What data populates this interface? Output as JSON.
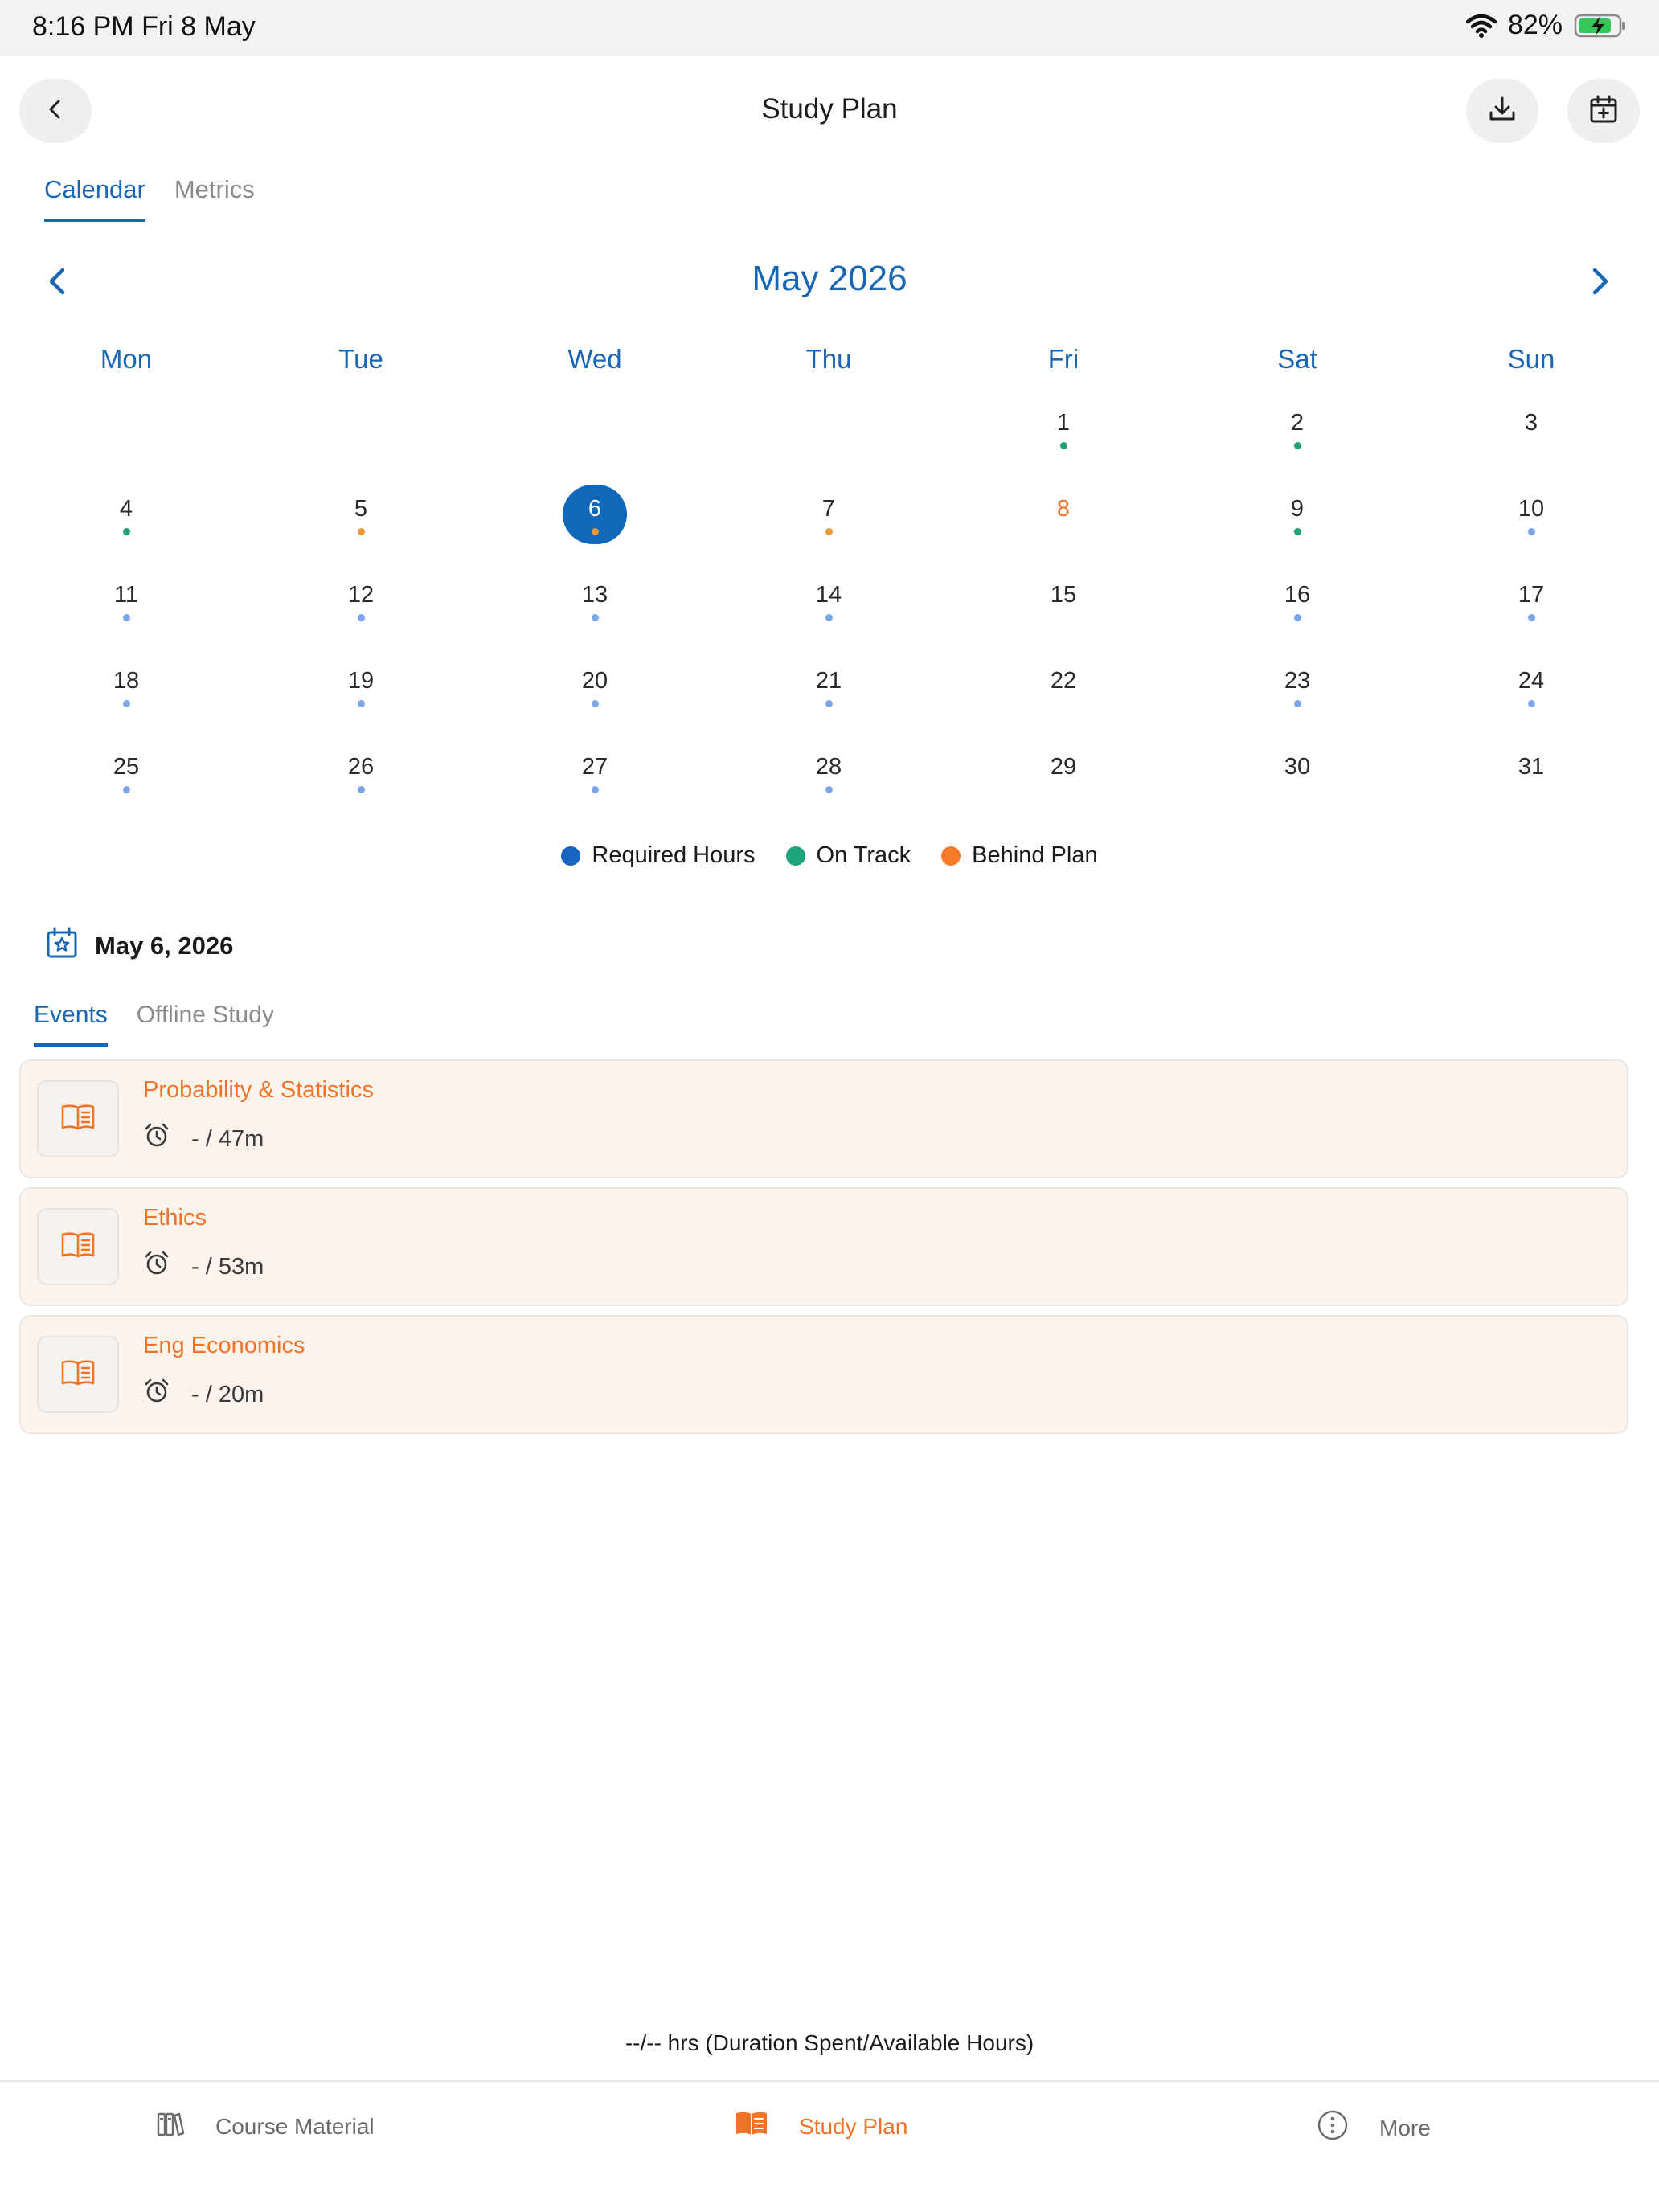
{
  "status_bar": {
    "time": "8:16 PM   Fri 8 May",
    "battery": "82%",
    "icons": [
      "wifi-icon",
      "battery-charging-icon"
    ]
  },
  "header": {
    "title": "Study Plan",
    "icons": [
      "chevron-left-icon",
      "download-icon",
      "calendar-add-icon"
    ]
  },
  "top_tabs": [
    {
      "label": "Calendar",
      "active": true
    },
    {
      "label": "Metrics",
      "active": false
    }
  ],
  "calendar": {
    "month_title": "May 2026",
    "weekdays": [
      "Mon",
      "Tue",
      "Wed",
      "Thu",
      "Fri",
      "Sat",
      "Sun"
    ],
    "selected_day": "6",
    "today": "8",
    "days": [
      {
        "d": "1",
        "col": 4,
        "row": 0,
        "dot": "green"
      },
      {
        "d": "2",
        "col": 5,
        "row": 0,
        "dot": "green"
      },
      {
        "d": "3",
        "col": 6,
        "row": 0,
        "dot": ""
      },
      {
        "d": "4",
        "col": 0,
        "row": 1,
        "dot": "green"
      },
      {
        "d": "5",
        "col": 1,
        "row": 1,
        "dot": "orange"
      },
      {
        "d": "6",
        "col": 2,
        "row": 1,
        "dot": "orange"
      },
      {
        "d": "7",
        "col": 3,
        "row": 1,
        "dot": "orange"
      },
      {
        "d": "8",
        "col": 4,
        "row": 1,
        "dot": ""
      },
      {
        "d": "9",
        "col": 5,
        "row": 1,
        "dot": "green"
      },
      {
        "d": "10",
        "col": 6,
        "row": 1,
        "dot": "blue"
      },
      {
        "d": "11",
        "col": 0,
        "row": 2,
        "dot": "blue"
      },
      {
        "d": "12",
        "col": 1,
        "row": 2,
        "dot": "blue"
      },
      {
        "d": "13",
        "col": 2,
        "row": 2,
        "dot": "blue"
      },
      {
        "d": "14",
        "col": 3,
        "row": 2,
        "dot": "blue"
      },
      {
        "d": "15",
        "col": 4,
        "row": 2,
        "dot": ""
      },
      {
        "d": "16",
        "col": 5,
        "row": 2,
        "dot": "blue"
      },
      {
        "d": "17",
        "col": 6,
        "row": 2,
        "dot": "blue"
      },
      {
        "d": "18",
        "col": 0,
        "row": 3,
        "dot": "blue"
      },
      {
        "d": "19",
        "col": 1,
        "row": 3,
        "dot": "blue"
      },
      {
        "d": "20",
        "col": 2,
        "row": 3,
        "dot": "blue"
      },
      {
        "d": "21",
        "col": 3,
        "row": 3,
        "dot": "blue"
      },
      {
        "d": "22",
        "col": 4,
        "row": 3,
        "dot": ""
      },
      {
        "d": "23",
        "col": 5,
        "row": 3,
        "dot": "blue"
      },
      {
        "d": "24",
        "col": 6,
        "row": 3,
        "dot": "blue"
      },
      {
        "d": "25",
        "col": 0,
        "row": 4,
        "dot": "blue"
      },
      {
        "d": "26",
        "col": 1,
        "row": 4,
        "dot": "blue"
      },
      {
        "d": "27",
        "col": 2,
        "row": 4,
        "dot": "blue"
      },
      {
        "d": "28",
        "col": 3,
        "row": 4,
        "dot": "blue"
      },
      {
        "d": "29",
        "col": 4,
        "row": 4,
        "dot": ""
      },
      {
        "d": "30",
        "col": 5,
        "row": 4,
        "dot": ""
      },
      {
        "d": "31",
        "col": 6,
        "row": 4,
        "dot": ""
      }
    ]
  },
  "legend": [
    {
      "label": "Required Hours",
      "color": "#1565c0"
    },
    {
      "label": "On Track",
      "color": "#1ea37a"
    },
    {
      "label": "Behind Plan",
      "color": "#f57a2a"
    }
  ],
  "dot_colors": {
    "green": "#1ea37a",
    "orange": "#e89a3a",
    "blue": "#7ba7e8",
    "today_text": "#f07327"
  },
  "selected_date": {
    "label": "May 6, 2026",
    "icon": "calendar-star-icon"
  },
  "sub_tabs": [
    {
      "label": "Events",
      "active": true
    },
    {
      "label": "Offline Study",
      "active": false
    }
  ],
  "events": [
    {
      "title": "Probability & Statistics",
      "time": "-  / 47m",
      "icon": "book-open-icon"
    },
    {
      "title": "Ethics",
      "time": "-  / 53m",
      "icon": "book-open-icon"
    },
    {
      "title": "Eng Economics",
      "time": "-  / 20m",
      "icon": "book-open-icon"
    }
  ],
  "summary": "--/-- hrs (Duration Spent/Available Hours)",
  "bottom_nav": [
    {
      "label": "Course Material",
      "icon": "books-icon",
      "active": false
    },
    {
      "label": "Study Plan",
      "icon": "book-open-icon",
      "active": true
    },
    {
      "label": "More",
      "icon": "more-circle-icon",
      "active": false
    }
  ]
}
